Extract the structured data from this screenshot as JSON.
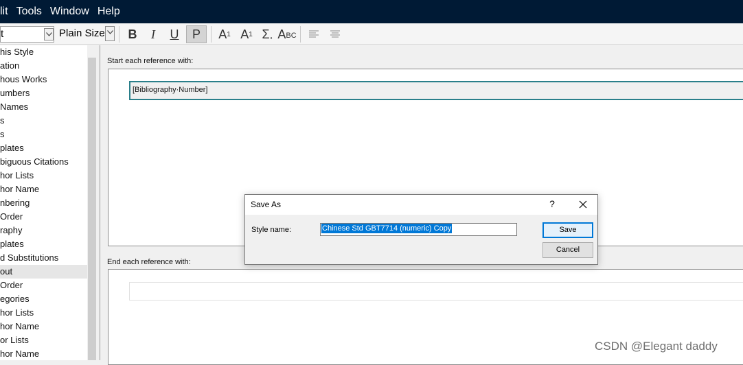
{
  "menubar": {
    "items": [
      "lit",
      "Tools",
      "Window",
      "Help"
    ]
  },
  "toolbar": {
    "font_value": "t",
    "size_value": "Plain Size",
    "bold_label": "B",
    "italic_label": "I",
    "underline_label": "U",
    "plain_label": "P",
    "superscript_label": "A",
    "superscript_mark": "1",
    "subscript_label": "A",
    "subscript_mark": "1",
    "symbol_label": "Σ",
    "smallcaps_label": "A",
    "smallcaps_mark": "BC"
  },
  "left_list": {
    "items": [
      "his Style",
      "ation",
      "hous Works",
      "umbers",
      " Names",
      "s",
      "s",
      "plates",
      "biguous Citations",
      "hor Lists",
      "hor Name",
      "nbering",
      " Order",
      "raphy",
      "plates",
      "d Substitutions",
      "out",
      " Order",
      "egories",
      "hor Lists",
      "hor Name",
      "or Lists",
      "hor Name"
    ],
    "selected_index": 16
  },
  "editor": {
    "start_label": "Start each reference with:",
    "start_field_value": "[Bibliography·Number]",
    "end_label": "End each reference with:",
    "end_field_value": ""
  },
  "dialog": {
    "title": "Save As",
    "help_label": "?",
    "style_name_label": "Style name:",
    "style_name_value": "Chinese Std GBT7714 (numeric) Copy",
    "save_label": "Save",
    "cancel_label": "Cancel"
  },
  "watermark": "CSDN @Elegant  daddy"
}
